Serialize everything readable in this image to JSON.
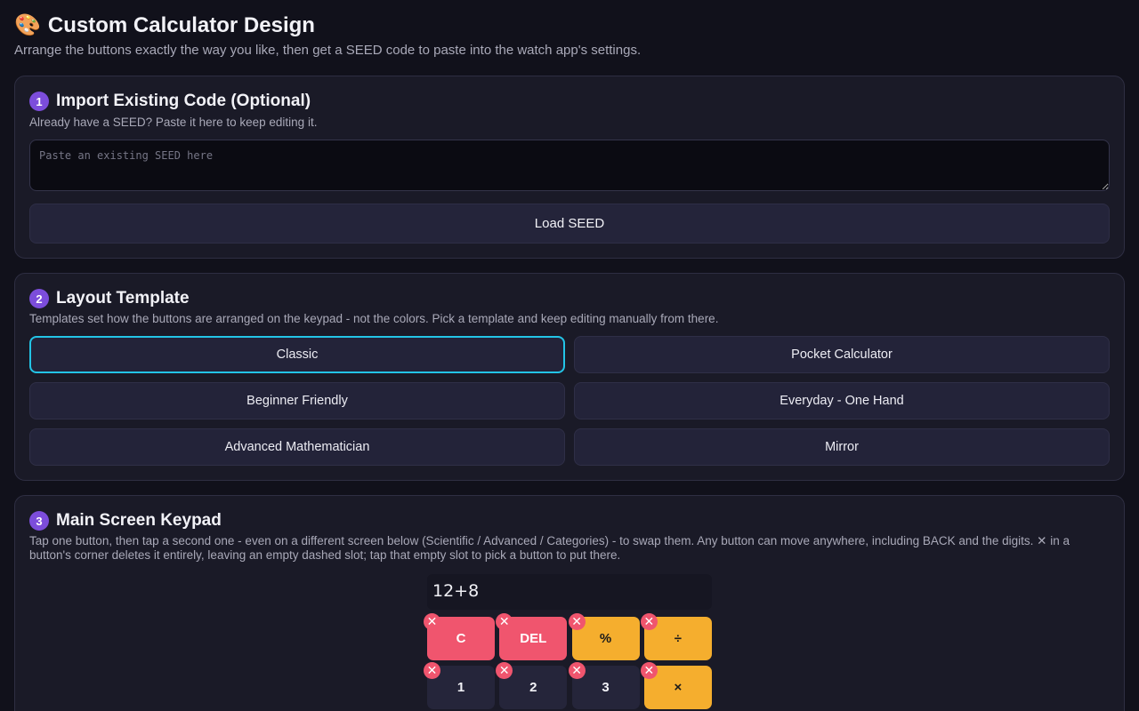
{
  "header": {
    "icon": "palette-icon",
    "icon_glyph": "🎨",
    "title": "Custom Calculator Design",
    "subtitle": "Arrange the buttons exactly the way you like, then get a SEED code to paste into the watch app's settings."
  },
  "import_section": {
    "step": "1",
    "title": "Import Existing Code (Optional)",
    "description": "Already have a SEED? Paste it here to keep editing it.",
    "seed_placeholder": "Paste an existing SEED here",
    "seed_value": "",
    "load_label": "Load SEED"
  },
  "template_section": {
    "step": "2",
    "title": "Layout Template",
    "description": "Templates set how the buttons are arranged on the keypad - not the colors. Pick a template and keep editing manually from there.",
    "selected": "Classic",
    "templates": [
      {
        "label": "Classic"
      },
      {
        "label": "Pocket Calculator"
      },
      {
        "label": "Beginner Friendly"
      },
      {
        "label": "Everyday - One Hand"
      },
      {
        "label": "Advanced Mathematician"
      },
      {
        "label": "Mirror"
      }
    ]
  },
  "keypad_section": {
    "step": "3",
    "title": "Main Screen Keypad",
    "description": "Tap one button, then tap a second one - even on a different screen below (Scientific / Advanced / Categories) - to swap them. Any button can move anywhere, including BACK and the digits. ✕ in a button's corner deletes it entirely, leaving an empty dashed slot; tap that empty slot to pick a button to put there.",
    "display_value": "12+8",
    "delete_glyph": "✕",
    "colors": {
      "red": "#f0556e",
      "orange": "#f5ae2e",
      "dark": "#25253a",
      "accent": "#23c4e6",
      "badge": "#7c4ddb"
    },
    "keys": [
      {
        "label": "C",
        "style": "red"
      },
      {
        "label": "DEL",
        "style": "red"
      },
      {
        "label": "%",
        "style": "orange"
      },
      {
        "label": "÷",
        "style": "orange"
      },
      {
        "label": "1",
        "style": "dark"
      },
      {
        "label": "2",
        "style": "dark"
      },
      {
        "label": "3",
        "style": "dark"
      },
      {
        "label": "×",
        "style": "orange"
      }
    ]
  }
}
